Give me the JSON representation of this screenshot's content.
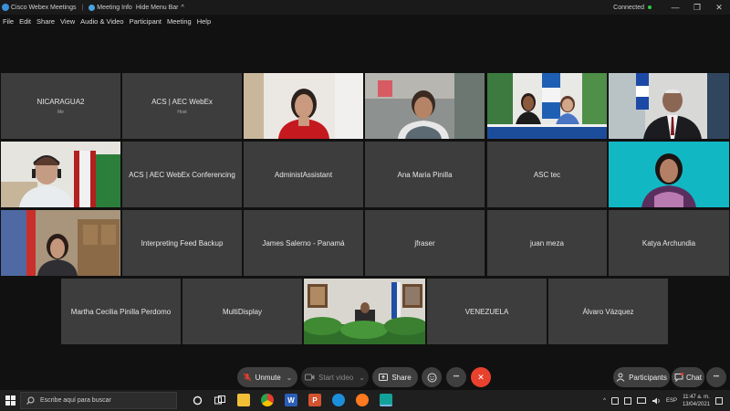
{
  "titlebar": {
    "app_title": "Cisco Webex Meetings",
    "sep": "|",
    "meeting_info": "Meeting Info",
    "hide_menu_bar": "Hide Menu Bar",
    "hide_chevron": "^",
    "status": "Connected"
  },
  "window_controls": {
    "minimize": "—",
    "restore": "❐",
    "close": "✕"
  },
  "menu": [
    "File",
    "Edit",
    "Share",
    "View",
    "Audio & Video",
    "Participant",
    "Meeting",
    "Help"
  ],
  "participants": [
    {
      "name": "NICARAGUA2",
      "sub": "Me"
    },
    {
      "name": "ACS | AEC WebEx",
      "sub": "Host"
    },
    {
      "name": "ACS | AEC WebEx Conferencing"
    },
    {
      "name": "AdministAssistant"
    },
    {
      "name": "Ana Maria Pinilla"
    },
    {
      "name": "ASC tec"
    },
    {
      "name": "Interpreting Feed Backup"
    },
    {
      "name": "James Salerno - Panamá"
    },
    {
      "name": "jfraser"
    },
    {
      "name": "juan meza"
    },
    {
      "name": "Katya Archundia"
    },
    {
      "name": "Martha Cecilia Pinilla Perdomo"
    },
    {
      "name": "MultiDisplay"
    },
    {
      "name": "VENEZUELA"
    },
    {
      "name": "Álvaro Vázquez"
    }
  ],
  "controls": {
    "unmute": "Unmute",
    "start_video": "Start video",
    "share": "Share",
    "participants": "Participants",
    "chat": "Chat",
    "more": "•••",
    "end": "✕",
    "chevron": "⌄"
  },
  "taskbar": {
    "search_placeholder": "Escribe aquí para buscar",
    "language": "ESP",
    "time": "11:47 a. m.",
    "date": "13/04/2021",
    "word_letter": "W",
    "ppt_letter": "P"
  },
  "colors": {
    "tile_bg": "#3d3d3d",
    "unmute_bg": "#3f3f3f",
    "end_bg": "#e8412d",
    "connected_dot": "#2ecc40",
    "accent": "#1f86c9"
  }
}
